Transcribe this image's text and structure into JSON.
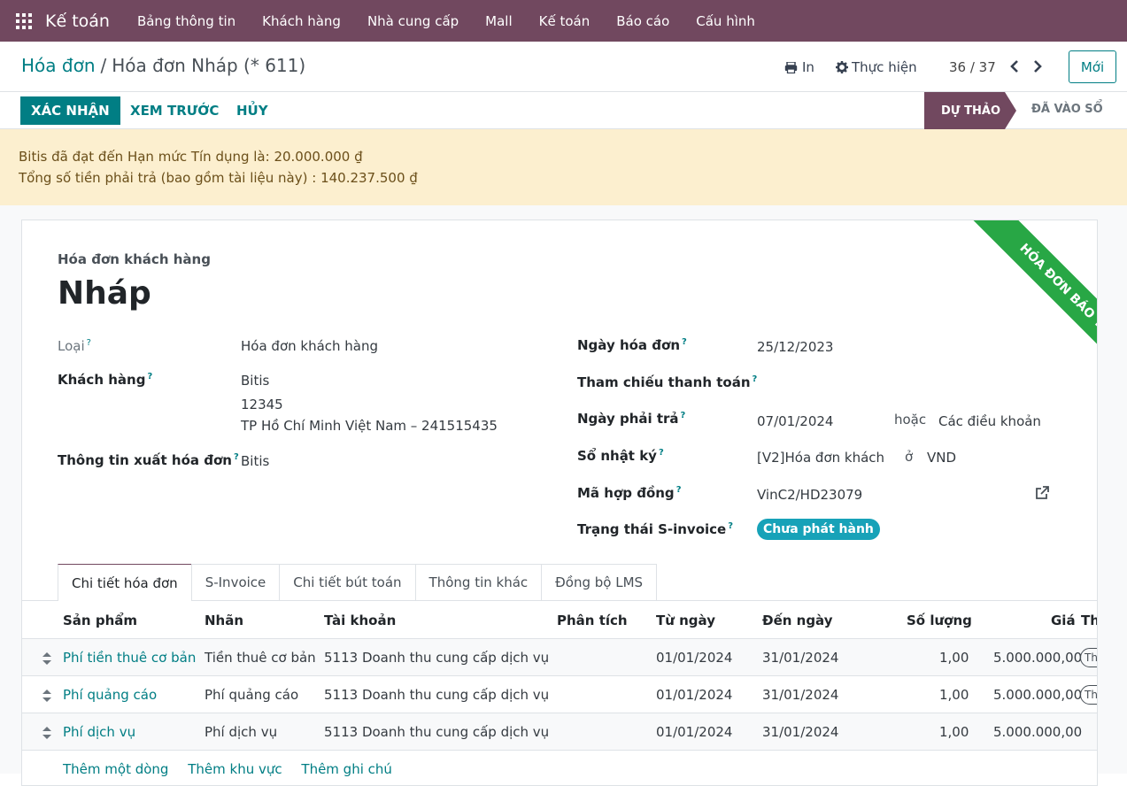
{
  "nav": {
    "app_name": "Kế toán",
    "menu": [
      "Bảng thông tin",
      "Khách hàng",
      "Nhà cung cấp",
      "Mall",
      "Kế toán",
      "Báo cáo",
      "Cấu hình"
    ]
  },
  "breadcrumb": {
    "parent": "Hóa đơn",
    "separator": "/",
    "current": "Hóa đơn Nháp (* 611)"
  },
  "actions": {
    "print": "In",
    "action": "Thực hiện"
  },
  "pager": {
    "value": "36 / 37"
  },
  "new_button": "Mới",
  "statusbar": {
    "confirm": "XÁC NHẬN",
    "preview": "XEM TRƯỚC",
    "cancel": "HỦY",
    "stage_active": "DỰ THẢO",
    "stage_next": "ĐÃ VÀO SỔ"
  },
  "alert": {
    "line1": "Bitis đã đạt đến Hạn mức Tín dụng là: 20.000.000 ₫",
    "line2": "Tổng số tiền phải trả (bao gồm tài liệu này) : 140.237.500 ₫"
  },
  "ribbon": "HÓA ĐƠN BÁO TRƯỚC",
  "doc": {
    "type": "Hóa đơn khách hàng",
    "name": "Nháp"
  },
  "tooltip_mark": "?",
  "fields": {
    "loai_label": "Loại",
    "loai_value": "Hóa đơn khách hàng",
    "customer_label": "Khách hàng",
    "customer_name": "Bitis",
    "customer_line2": "12345",
    "customer_line3": "TP Hồ Chí Minh Việt Nam – 241515435",
    "billing_label": "Thông tin xuất hóa đơn",
    "billing_value": "Bitis",
    "invoice_date_label": "Ngày hóa đơn",
    "invoice_date": "25/12/2023",
    "payment_ref_label": "Tham chiếu thanh toán",
    "due_date_label": "Ngày phải trả",
    "due_date": "07/01/2024",
    "or": "hoặc",
    "terms": "Các điều khoản",
    "journal_label": "Sổ nhật ký",
    "journal": "[V2]Hóa đơn khách",
    "in": "ở",
    "currency": "VND",
    "contract_label": "Mã hợp đồng",
    "contract": "VinC2/HD23079",
    "sinvoice_label": "Trạng thái S-invoice",
    "sinvoice_status": "Chưa phát hành"
  },
  "tabs": [
    "Chi tiết hóa đơn",
    "S-Invoice",
    "Chi tiết bút toán",
    "Thông tin khác",
    "Đồng bộ LMS"
  ],
  "table": {
    "headers": {
      "product": "Sản phẩm",
      "label": "Nhãn",
      "account": "Tài khoản",
      "analytic": "Phân tích",
      "from": "Từ ngày",
      "to": "Đến ngày",
      "qty": "Số lượng",
      "price": "Giá",
      "tax": "Th"
    },
    "rows": [
      {
        "product": "Phí tiền thuê cơ bản",
        "label": "Tiền thuê cơ bản",
        "account": "5113 Doanh thu cung cấp dịch vụ",
        "from": "01/01/2024",
        "to": "31/01/2024",
        "qty": "1,00",
        "price": "5.000.000,00",
        "tax": "Th"
      },
      {
        "product": "Phí quảng cáo",
        "label": "Phí quảng cáo",
        "account": "5113 Doanh thu cung cấp dịch vụ",
        "from": "01/01/2024",
        "to": "31/01/2024",
        "qty": "1,00",
        "price": "5.000.000,00",
        "tax": "Th"
      },
      {
        "product": "Phí dịch vụ",
        "label": "Phí dịch vụ",
        "account": "5113 Doanh thu cung cấp dịch vụ",
        "from": "01/01/2024",
        "to": "31/01/2024",
        "qty": "1,00",
        "price": "5.000.000,00",
        "tax": ""
      }
    ],
    "add_line": "Thêm một dòng",
    "add_section": "Thêm khu vực",
    "add_note": "Thêm ghi chú"
  },
  "colors": {
    "brand": "#71485f",
    "accent": "#017e84",
    "alert_bg": "#fcefcf",
    "ribbon": "#28a745",
    "badge": "#17a2b8"
  }
}
